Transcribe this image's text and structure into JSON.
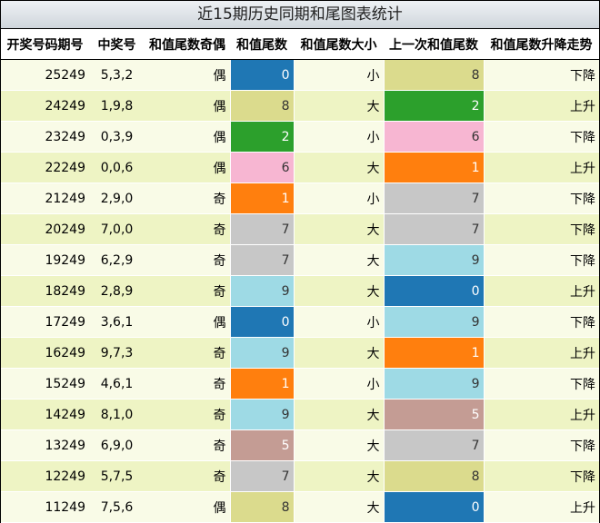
{
  "title": "近15期历史同期和尾图表统计",
  "headers": [
    "开奖号码期号",
    "中奖号",
    "和值尾数奇偶",
    "和值尾数",
    "和值尾数大小",
    "上一次和值尾数",
    "和值尾数升降走势"
  ],
  "digit_colors": {
    "0": {
      "bg": "#1f77b4",
      "fg": "#ffffff"
    },
    "1": {
      "bg": "#ff7f0e",
      "fg": "#ffffff"
    },
    "2": {
      "bg": "#2ca02c",
      "fg": "#ffffff"
    },
    "5": {
      "bg": "#c49c94",
      "fg": "#ffffff"
    },
    "6": {
      "bg": "#f7b6d2",
      "fg": "#333333"
    },
    "7": {
      "bg": "#c7c7c7",
      "fg": "#333333"
    },
    "8": {
      "bg": "#dbdb8d",
      "fg": "#333333"
    },
    "9": {
      "bg": "#9edae5",
      "fg": "#333333"
    }
  },
  "rows": [
    {
      "issue": "25249",
      "numbers": "5,3,2",
      "parity": "偶",
      "tail": "0",
      "size": "小",
      "prev_tail": "8",
      "trend": "下降"
    },
    {
      "issue": "24249",
      "numbers": "1,9,8",
      "parity": "偶",
      "tail": "8",
      "size": "大",
      "prev_tail": "2",
      "trend": "上升"
    },
    {
      "issue": "23249",
      "numbers": "0,3,9",
      "parity": "偶",
      "tail": "2",
      "size": "小",
      "prev_tail": "6",
      "trend": "下降"
    },
    {
      "issue": "22249",
      "numbers": "0,0,6",
      "parity": "偶",
      "tail": "6",
      "size": "大",
      "prev_tail": "1",
      "trend": "上升"
    },
    {
      "issue": "21249",
      "numbers": "2,9,0",
      "parity": "奇",
      "tail": "1",
      "size": "小",
      "prev_tail": "7",
      "trend": "下降"
    },
    {
      "issue": "20249",
      "numbers": "7,0,0",
      "parity": "奇",
      "tail": "7",
      "size": "大",
      "prev_tail": "7",
      "trend": "下降"
    },
    {
      "issue": "19249",
      "numbers": "6,2,9",
      "parity": "奇",
      "tail": "7",
      "size": "大",
      "prev_tail": "9",
      "trend": "下降"
    },
    {
      "issue": "18249",
      "numbers": "2,8,9",
      "parity": "奇",
      "tail": "9",
      "size": "大",
      "prev_tail": "0",
      "trend": "上升"
    },
    {
      "issue": "17249",
      "numbers": "3,6,1",
      "parity": "偶",
      "tail": "0",
      "size": "小",
      "prev_tail": "9",
      "trend": "下降"
    },
    {
      "issue": "16249",
      "numbers": "9,7,3",
      "parity": "奇",
      "tail": "9",
      "size": "大",
      "prev_tail": "1",
      "trend": "上升"
    },
    {
      "issue": "15249",
      "numbers": "4,6,1",
      "parity": "奇",
      "tail": "1",
      "size": "小",
      "prev_tail": "9",
      "trend": "下降"
    },
    {
      "issue": "14249",
      "numbers": "8,1,0",
      "parity": "奇",
      "tail": "9",
      "size": "大",
      "prev_tail": "5",
      "trend": "上升"
    },
    {
      "issue": "13249",
      "numbers": "6,9,0",
      "parity": "奇",
      "tail": "5",
      "size": "大",
      "prev_tail": "7",
      "trend": "下降"
    },
    {
      "issue": "12249",
      "numbers": "5,7,5",
      "parity": "奇",
      "tail": "7",
      "size": "大",
      "prev_tail": "8",
      "trend": "下降"
    },
    {
      "issue": "11249",
      "numbers": "7,5,6",
      "parity": "偶",
      "tail": "8",
      "size": "大",
      "prev_tail": "0",
      "trend": "上升"
    }
  ]
}
